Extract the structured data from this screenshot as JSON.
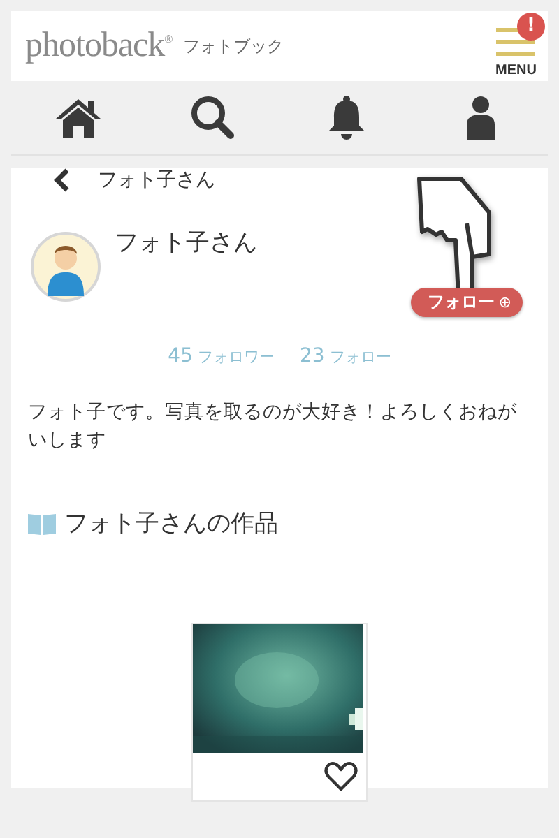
{
  "header": {
    "logo": "photoback",
    "registered": "®",
    "subtitle": "フォトブック",
    "menu_label": "MENU",
    "menu_badge": "!"
  },
  "nav": [
    {
      "kind": "home"
    },
    {
      "kind": "search"
    },
    {
      "kind": "bell"
    },
    {
      "kind": "user"
    }
  ],
  "back_title": "フォト子さん",
  "profile": {
    "name": "フォト子さん",
    "follow_button": "フォロー",
    "follow_icon": "⊕",
    "followers_count": "45",
    "followers_label": "フォロワー",
    "following_count": "23",
    "following_label": "フォロー",
    "bio": "フォト子です。写真を取るのが大好き！よろしくおねがいします"
  },
  "works_heading": "フォト子さんの作品"
}
